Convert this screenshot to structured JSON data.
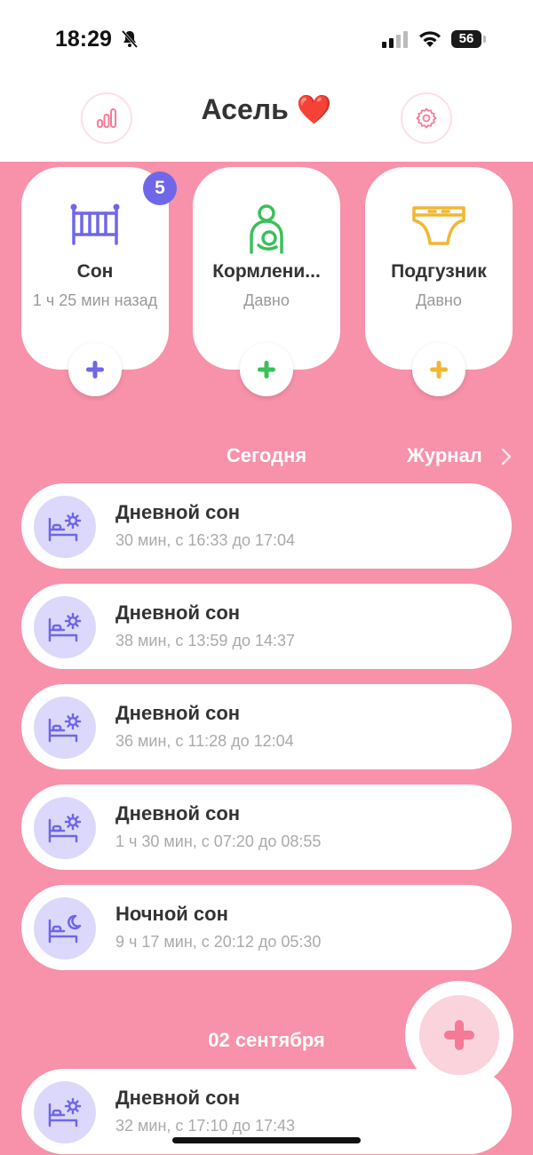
{
  "status": {
    "time": "18:29",
    "battery": "56"
  },
  "header": {
    "title": "Асель ❤️"
  },
  "cards": [
    {
      "title": "Сон",
      "sub": "1 ч 25 мин назад",
      "badge": "5",
      "color": "#6f67e8"
    },
    {
      "title": "Кормлени...",
      "sub": "Давно",
      "color": "#3ac05a"
    },
    {
      "title": "Подгузник",
      "sub": "Давно",
      "color": "#f2b632"
    }
  ],
  "sections": {
    "today": "Сегодня",
    "journal": "Журнал",
    "prev_date": "02 сентября"
  },
  "entries": [
    {
      "title": "Дневной сон",
      "sub": "30 мин, с 16:33 до 17:04",
      "icon": "bed-sun-icon"
    },
    {
      "title": "Дневной сон",
      "sub": "38 мин, с 13:59 до 14:37",
      "icon": "bed-sun-icon"
    },
    {
      "title": "Дневной сон",
      "sub": "36 мин, с 11:28 до 12:04",
      "icon": "bed-sun-icon"
    },
    {
      "title": "Дневной сон",
      "sub": "1 ч 30 мин, с 07:20 до 08:55",
      "icon": "bed-sun-icon"
    },
    {
      "title": "Ночной сон",
      "sub": "9 ч 17 мин, с 20:12 до 05:30",
      "icon": "bed-moon-icon"
    },
    {
      "title": "Дневной сон",
      "sub": "32 мин, с 17:10 до 17:43",
      "icon": "bed-sun-icon"
    }
  ],
  "colors": {
    "background": "#f891aa",
    "accent_pink": "#f47a98",
    "sleep_purple": "#6f67e8"
  }
}
